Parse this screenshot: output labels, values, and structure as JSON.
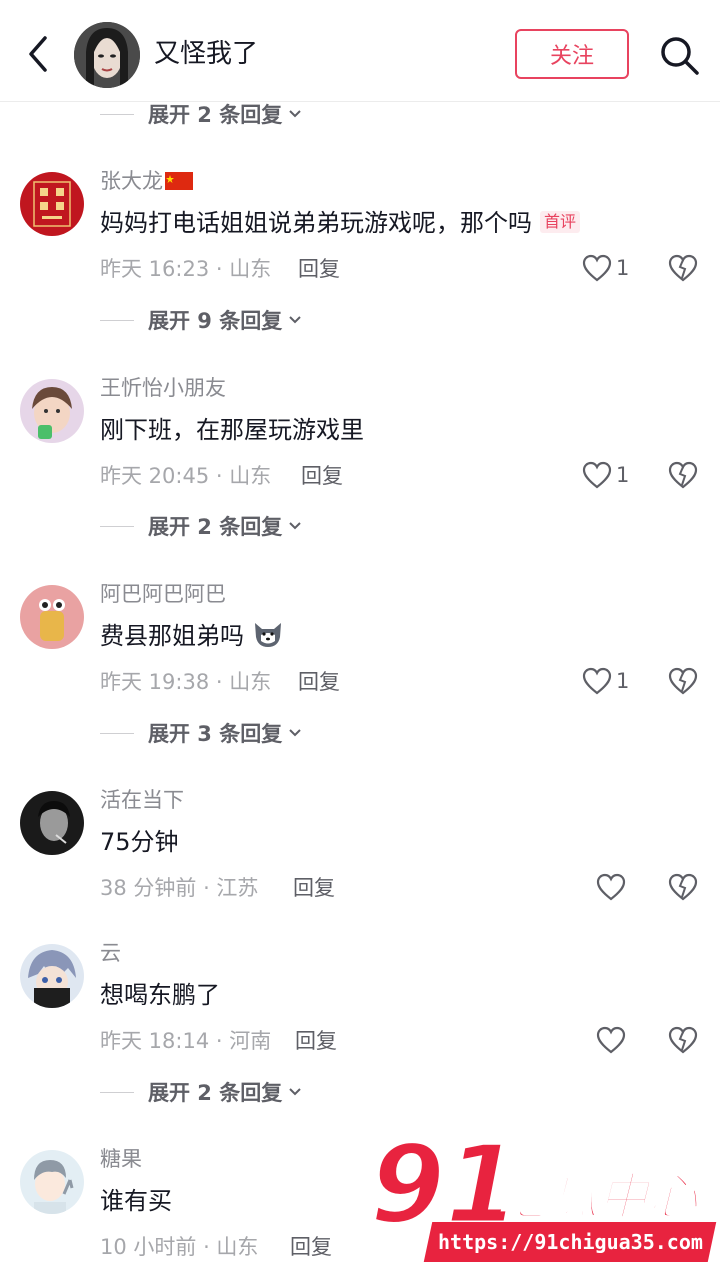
{
  "header": {
    "title": "又怪我了",
    "follow_label": "关注"
  },
  "top_expand": {
    "label": "展开 2 条回复"
  },
  "comments": [
    {
      "username": "张大龙",
      "content": "妈妈打电话姐姐说弟弟玩游戏呢，那个吗",
      "badge": "首评",
      "meta": "昨天 16:23 · 山东",
      "reply": "回复",
      "likes": "1",
      "expand": "展开 9 条回复"
    },
    {
      "username": "王忻怡小朋友",
      "content": "刚下班，在那屋玩游戏里",
      "meta": "昨天 20:45 · 山东",
      "reply": "回复",
      "likes": "1",
      "expand": "展开 2 条回复"
    },
    {
      "username": "阿巴阿巴阿巴",
      "content": "费县那姐弟吗",
      "meta": "昨天 19:38 · 山东",
      "reply": "回复",
      "likes": "1",
      "expand": "展开 3 条回复"
    },
    {
      "username": "活在当下",
      "content": "75分钟",
      "meta": "38 分钟前 · 江苏",
      "reply": "回复",
      "likes": ""
    },
    {
      "username": "云",
      "content": "想喝东鹏了",
      "meta": "昨天 18:14 · 河南",
      "reply": "回复",
      "likes": "",
      "expand": "展开 2 条回复"
    },
    {
      "username": "糖果",
      "content": "谁有买",
      "meta": "10 小时前 · 山东",
      "reply": "回复"
    }
  ],
  "watermark": {
    "brand_number": "91",
    "brand_text": "吃瓜中心",
    "url": "https://91chigua35.com"
  },
  "colors": {
    "accent": "#e8435f",
    "text_primary": "#161823",
    "text_secondary": "#8a8b91",
    "watermark_red": "#e8233f"
  }
}
